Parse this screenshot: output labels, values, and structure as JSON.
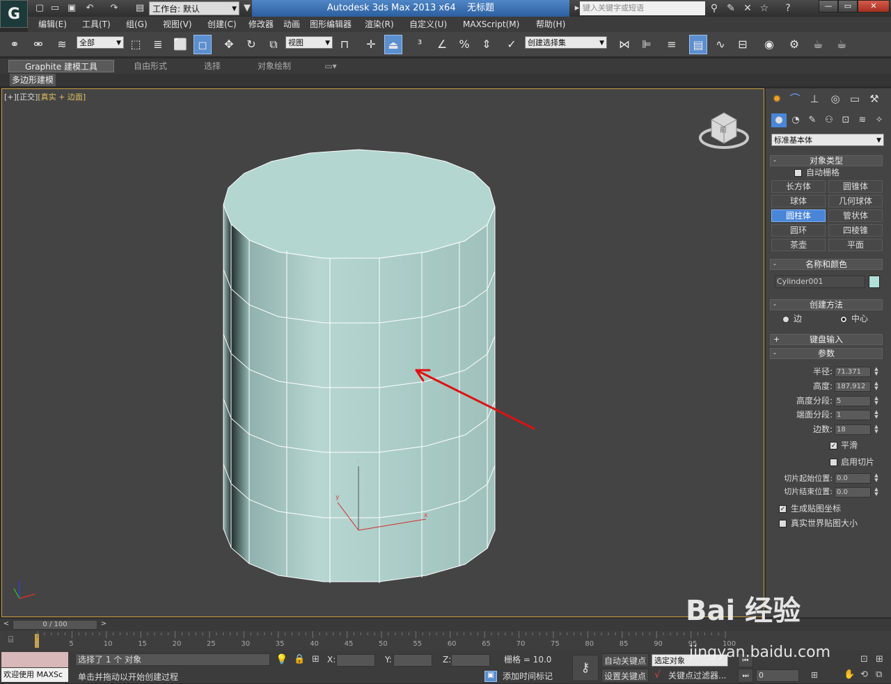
{
  "titlebar": {
    "workspace_label": "工作台: 默认",
    "app_title": "Autodesk 3ds Max  2013 x64",
    "doc_title": "无标题",
    "search_placeholder": "键入关键字或短语"
  },
  "menu": [
    "编辑(E)",
    "工具(T)",
    "组(G)",
    "视图(V)",
    "创建(C)",
    "修改器",
    "动画",
    "图形编辑器",
    "渲染(R)",
    "自定义(U)",
    "MAXScript(M)",
    "帮助(H)"
  ],
  "toolbar": {
    "filter_value": "全部",
    "refcoord_value": "视图",
    "selection_set_value": "创建选择集"
  },
  "ribbon": {
    "tabs": [
      "Graphite 建模工具",
      "自由形式",
      "选择",
      "对象绘制"
    ],
    "sub_label": "多边形建模"
  },
  "viewport": {
    "label_a": "[+][正交]",
    "label_b": "[真实 + 边面]",
    "cube_label": "前",
    "axis_labels": [
      "z",
      "y",
      "x"
    ]
  },
  "cmdpanel": {
    "category_value": "标准基本体",
    "object_type": {
      "header": "对象类型",
      "autogrid_label": "自动栅格",
      "buttons": [
        "长方体",
        "圆锥体",
        "球体",
        "几何球体",
        "圆柱体",
        "管状体",
        "圆环",
        "四棱锥",
        "茶壶",
        "平面"
      ],
      "active_button": "圆柱体"
    },
    "name_color": {
      "header": "名称和颜色",
      "name": "Cylinder001",
      "color": "#b0e0d8"
    },
    "creation_method": {
      "header": "创建方法",
      "options": [
        "边",
        "中心"
      ],
      "selected": "中心"
    },
    "keyboard_entry": {
      "header": "键盘输入"
    },
    "parameters": {
      "header": "参数",
      "fields": [
        {
          "label": "半径:",
          "value": "71.371"
        },
        {
          "label": "高度:",
          "value": "187.912"
        },
        {
          "label": "高度分段:",
          "value": "5"
        },
        {
          "label": "端面分段:",
          "value": "1"
        },
        {
          "label": "边数:",
          "value": "18"
        }
      ],
      "smooth_label": "平滑",
      "smooth_checked": true,
      "slice_label": "启用切片",
      "slice_from_label": "切片起始位置:",
      "slice_from_value": "0.0",
      "slice_to_label": "切片结束位置:",
      "slice_to_value": "0.0",
      "gen_uv_label": "生成贴图坐标",
      "gen_uv_checked": true,
      "realworld_label": "真实世界贴图大小"
    }
  },
  "timeline": {
    "frame_display": "0 / 100",
    "ticks": [
      "0",
      "5",
      "10",
      "15",
      "20",
      "25",
      "30",
      "35",
      "40",
      "45",
      "50",
      "55",
      "60",
      "65",
      "70",
      "75",
      "80",
      "85",
      "90",
      "95",
      "100"
    ]
  },
  "status": {
    "welcome": "欢迎使用 MAXSc",
    "selection_text": "选择了 1 个 对象",
    "prompt_text": "单击并拖动以开始创建过程",
    "x_label": "X:",
    "y_label": "Y:",
    "z_label": "Z:",
    "grid_text": "栅格 = 10.0",
    "add_time_tag": "添加时间标记",
    "auto_key": "自动关键点",
    "set_key": "设置关键点",
    "key_mode_value": "选定对象",
    "key_filters": "关键点过滤器...",
    "frame_value": "0"
  },
  "watermark": {
    "logo": "Bai 经验",
    "url": "jingyan.baidu.com"
  },
  "colors": {
    "cylinder": "#b3d6d0",
    "arrow": "#e01010",
    "active_blue": "#4a86d8"
  }
}
